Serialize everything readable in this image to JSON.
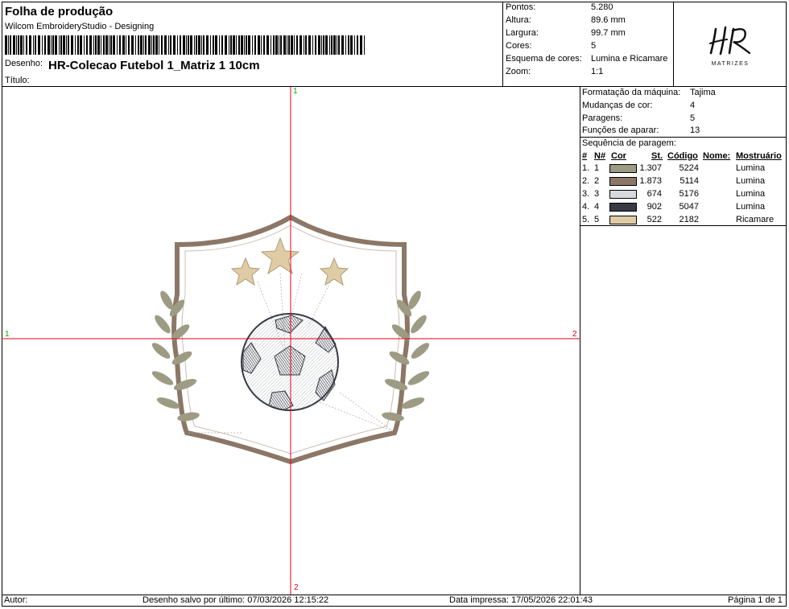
{
  "header": {
    "title": "Folha de produção",
    "subtitle": "Wilcom EmbroideryStudio - Designing",
    "desenho_label": "Desenho:",
    "desenho_value": "HR-Colecao Futebol 1_Matriz 1 10cm",
    "titulo_label": "Título:"
  },
  "stats": {
    "pontos_label": "Pontos:",
    "pontos_value": "5.280",
    "altura_label": "Altura:",
    "altura_value": "89.6 mm",
    "largura_label": "Largura:",
    "largura_value": "99.7 mm",
    "cores_label": "Cores:",
    "cores_value": "5",
    "esquema_label": "Esquema de cores:",
    "esquema_value": "Lumina e Ricamare",
    "zoom_label": "Zoom:",
    "zoom_value": "1:1"
  },
  "logo": {
    "mark": "HR",
    "text": "MATRIZES"
  },
  "machine": {
    "formatacao_label": "Formatação da máquina:",
    "formatacao_value": "Tajima",
    "mudancas_label": "Mudanças de cor:",
    "mudancas_value": "4",
    "paragens_label": "Paragens:",
    "paragens_value": "5",
    "funcoes_label": "Funções de aparar:",
    "funcoes_value": "13",
    "sequencia_label": "Sequência de paragem:"
  },
  "table": {
    "headers": {
      "num": "#",
      "n": "N#",
      "cor": "Cor",
      "st": "St.",
      "codigo": "Código",
      "nome": "Nome:",
      "mostruario": "Mostruário"
    },
    "rows": [
      {
        "num": "1.",
        "n": "1",
        "color": "#9d9b83",
        "st": "1.307",
        "codigo": "5224",
        "mostruario": "Lumina"
      },
      {
        "num": "2.",
        "n": "2",
        "color": "#8c7766",
        "st": "1.873",
        "codigo": "5114",
        "mostruario": "Lumina"
      },
      {
        "num": "3.",
        "n": "3",
        "color": "#d6dadc",
        "st": "674",
        "codigo": "5176",
        "mostruario": "Lumina"
      },
      {
        "num": "4.",
        "n": "4",
        "color": "#363a44",
        "st": "902",
        "codigo": "5047",
        "mostruario": "Lumina"
      },
      {
        "num": "5.",
        "n": "5",
        "color": "#dfcca5",
        "st": "522",
        "codigo": "2182",
        "mostruario": "Ricamare"
      }
    ]
  },
  "axis": {
    "top": "1",
    "bottom": "2",
    "left": "1",
    "right": "2"
  },
  "footer": {
    "autor": "Autor:",
    "salvo": "Desenho salvo por último: 07/03/2026 12:15:22",
    "impressa": "Data impressa: 17/05/2026 22:01:43",
    "pagina": "Página 1 de 1"
  }
}
